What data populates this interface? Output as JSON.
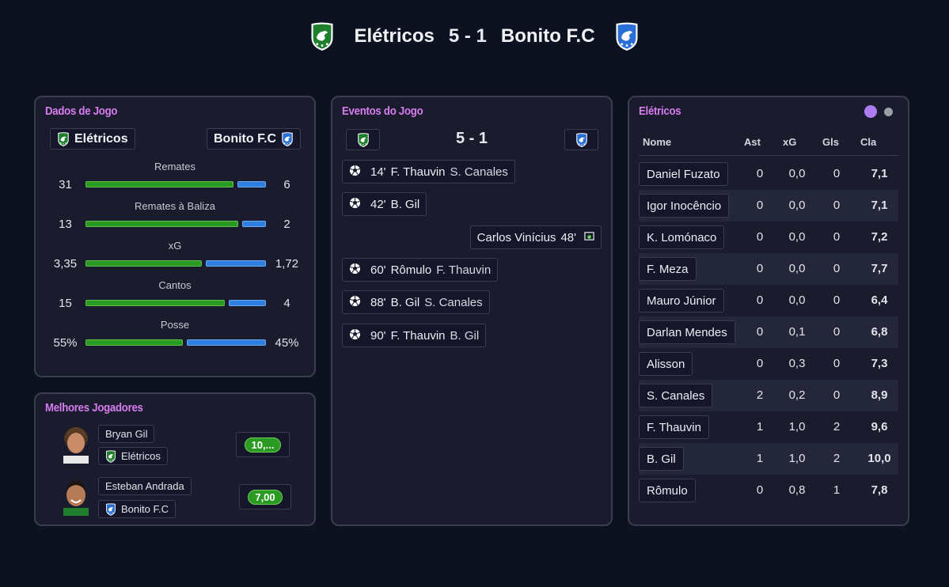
{
  "header": {
    "home": "Elétricos",
    "score": "5 - 1",
    "away": "Bonito F.C"
  },
  "colors": {
    "home_primary": "#1f7f2c",
    "away_primary": "#2a6fd6",
    "accent_title": "#d77cf0",
    "rating_green": "#2a9a23"
  },
  "dados": {
    "title": "Dados de Jogo",
    "home": "Elétricos",
    "away": "Bonito F.C",
    "stats": [
      {
        "label": "Remates",
        "home": "31",
        "away": "6",
        "home_frac": 0.838,
        "away_frac": 0.162
      },
      {
        "label": "Remates à Baliza",
        "home": "13",
        "away": "2",
        "home_frac": 0.867,
        "away_frac": 0.133
      },
      {
        "label": "xG",
        "home": "3,35",
        "away": "1,72",
        "home_frac": 0.661,
        "away_frac": 0.339
      },
      {
        "label": "Cantos",
        "home": "15",
        "away": "4",
        "home_frac": 0.789,
        "away_frac": 0.211
      },
      {
        "label": "Posse",
        "home": "55%",
        "away": "45%",
        "home_frac": 0.55,
        "away_frac": 0.45
      }
    ]
  },
  "melhores": {
    "title": "Melhores Jogadores",
    "players": [
      {
        "name": "Bryan Gil",
        "team": "Elétricos",
        "rating": "10,..."
      },
      {
        "name": "Esteban Andrada",
        "team": "Bonito F.C",
        "rating": "7,00"
      }
    ]
  },
  "eventos": {
    "title": "Eventos do Jogo",
    "score": "5 - 1",
    "events": [
      {
        "minute": "14'",
        "scorer": "F. Thauvin",
        "assist": "S. Canales",
        "side": "home"
      },
      {
        "minute": "42'",
        "scorer": "B. Gil",
        "assist": "",
        "side": "home"
      },
      {
        "minute": "48'",
        "scorer": "Carlos Vinícius",
        "assist": "",
        "side": "away"
      },
      {
        "minute": "60'",
        "scorer": "Rômulo",
        "assist": "F. Thauvin",
        "side": "home"
      },
      {
        "minute": "88'",
        "scorer": "B. Gil",
        "assist": "S. Canales",
        "side": "home"
      },
      {
        "minute": "90'",
        "scorer": "F. Thauvin",
        "assist": "B. Gil",
        "side": "home"
      }
    ]
  },
  "eletricos": {
    "title": "Elétricos",
    "columns": [
      "Nome",
      "Ast",
      "xG",
      "Gls",
      "Cla"
    ],
    "rows": [
      [
        "Daniel Fuzato",
        "0",
        "0,0",
        "0",
        "7,1"
      ],
      [
        "Igor Inocêncio",
        "0",
        "0,0",
        "0",
        "7,1"
      ],
      [
        "K. Lomónaco",
        "0",
        "0,0",
        "0",
        "7,2"
      ],
      [
        "F. Meza",
        "0",
        "0,0",
        "0",
        "7,7"
      ],
      [
        "Mauro Júnior",
        "0",
        "0,0",
        "0",
        "6,4"
      ],
      [
        "Darlan Mendes",
        "0",
        "0,1",
        "0",
        "6,8"
      ],
      [
        "Alisson",
        "0",
        "0,3",
        "0",
        "7,3"
      ],
      [
        "S. Canales",
        "2",
        "0,2",
        "0",
        "8,9"
      ],
      [
        "F. Thauvin",
        "1",
        "1,0",
        "2",
        "9,6"
      ],
      [
        "B. Gil",
        "1",
        "1,0",
        "2",
        "10,0"
      ],
      [
        "Rômulo",
        "0",
        "0,8",
        "1",
        "7,8"
      ]
    ]
  }
}
